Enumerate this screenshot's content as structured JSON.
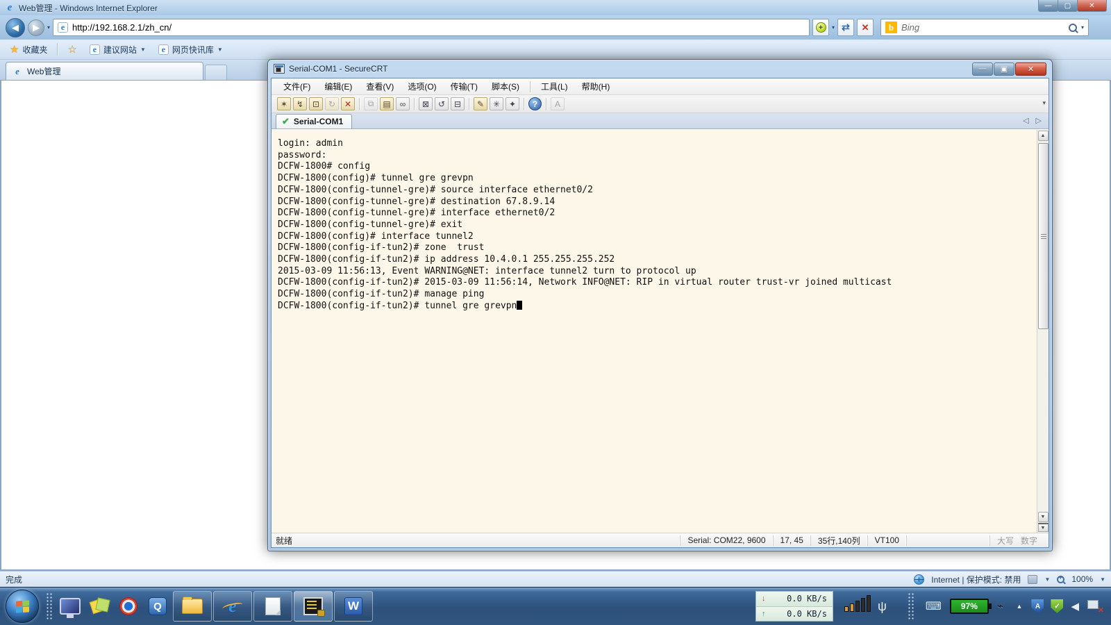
{
  "ie": {
    "title": "Web管理 - Windows Internet Explorer",
    "url": "http://192.168.2.1/zh_cn/",
    "search": {
      "placeholder": "Bing"
    },
    "favorites": {
      "label": "收藏夹",
      "suggested": "建议网站",
      "webslice": "网页快讯库"
    },
    "tab": {
      "label": "Web管理"
    },
    "status": {
      "done": "完成",
      "zone": "Internet | 保护模式: 禁用",
      "zoom": "100%"
    }
  },
  "scrt": {
    "title": "Serial-COM1 - SecureCRT",
    "menu": [
      "文件(F)",
      "编辑(E)",
      "查看(V)",
      "选项(O)",
      "传输(T)",
      "脚本(S)",
      "工具(L)",
      "帮助(H)"
    ],
    "toolbar_icons": [
      "connect",
      "quick-connect",
      "connect-in-tab",
      "reconnect",
      "disconnect",
      "copy",
      "paste",
      "find",
      "clear-screen",
      "reset-terminal",
      "print",
      "session-options",
      "keymap",
      "key-agent",
      "help",
      "theme"
    ],
    "tab": {
      "label": "Serial-COM1"
    },
    "terminal": {
      "lines": [
        "login: admin",
        "password:",
        "DCFW-1800# config",
        "DCFW-1800(config)# tunnel gre grevpn",
        "DCFW-1800(config-tunnel-gre)# source interface ethernet0/2",
        "DCFW-1800(config-tunnel-gre)# destination 67.8.9.14",
        "DCFW-1800(config-tunnel-gre)# interface ethernet0/2",
        "DCFW-1800(config-tunnel-gre)# exit",
        "DCFW-1800(config)# interface tunnel2",
        "DCFW-1800(config-if-tun2)# zone  trust",
        "DCFW-1800(config-if-tun2)# ip address 10.4.0.1 255.255.255.252",
        "2015-03-09 11:56:13, Event WARNING@NET: interface tunnel2 turn to protocol up",
        "DCFW-1800(config-if-tun2)# 2015-03-09 11:56:14, Network INFO@NET: RIP in virtual router trust-vr joined multicast",
        "",
        "DCFW-1800(config-if-tun2)# manage ping",
        "DCFW-1800(config-if-tun2)# tunnel gre grevpn"
      ]
    },
    "status": {
      "ready": "就绪",
      "serial": "Serial: COM22, 9600",
      "cursor_pos": "17, 45",
      "grid": "35行,140列",
      "emulation": "VT100",
      "caps": "大写",
      "num": "数字"
    }
  },
  "taskbar": {
    "net_down": "0.0 KB/s",
    "net_up": "0.0 KB/s",
    "battery": "97%"
  },
  "colors": {
    "terminal_bg": "#fcf7e8",
    "aero_blue": "#a9c7e3",
    "taskbar_blue": "#2d517c",
    "battery_green": "#2db52d",
    "close_red": "#b4331e"
  }
}
